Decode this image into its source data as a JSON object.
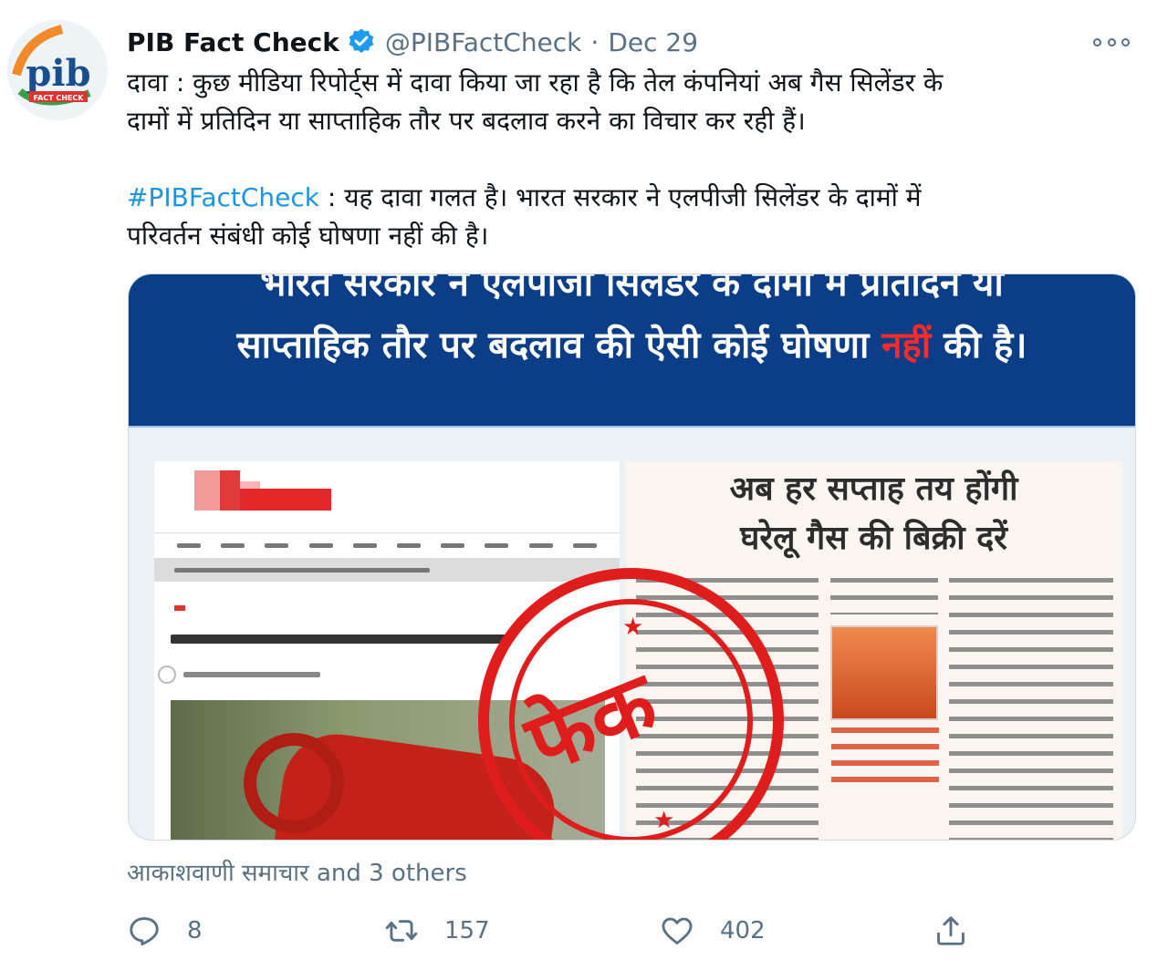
{
  "tweet": {
    "author_name": "PIB Fact Check",
    "handle": "@PIBFactCheck",
    "separator": "·",
    "date": "Dec 29",
    "avatar_logo_text": "pib",
    "avatar_sub_text": "FACT CHECK",
    "text_line1": "दावा : कुछ मीडिया रिपोर्ट्स में दावा किया जा रहा है कि तेल कंपनियां अब गैस सिलेंडर के",
    "text_line2": "दामों में प्रतिदिन या साप्ताहिक तौर पर बदलाव करने का विचार कर रही हैं।",
    "hashtag": "#PIBFactCheck",
    "text_line3_rest": " : यह दावा गलत है। भारत सरकार ने एलपीजी सिलेंडर के दामों में",
    "text_line4": "परिवर्तन संबंधी कोई घोषणा नहीं की है।"
  },
  "media": {
    "banner_line1": "भारत सरकार ने एलपीजी सिलेंडर के दामों में प्रतिदिन या",
    "banner_line2_start": "साप्ताहिक तौर पर बदलाव की ऐसी कोई घोषणा ",
    "banner_line2_red": "नहीं",
    "banner_line2_end": " की है।",
    "newspaper_headline1": "अब हर सप्ताह तय होंगी",
    "newspaper_headline2": "घरेलू गैस की बिक्री दरें",
    "stamp_text": "फेक"
  },
  "social_context": "आकाशवाणी समाचार and 3 others",
  "actions": {
    "reply_count": "8",
    "retweet_count": "157",
    "like_count": "402"
  },
  "icons": {
    "verified": "verified-badge-icon",
    "more": "more-options-icon",
    "reply": "reply-icon",
    "retweet": "retweet-icon",
    "like": "heart-icon",
    "share": "share-icon"
  },
  "colors": {
    "link": "#1b95e0",
    "muted": "#5b7083",
    "banner": "#0b3e87",
    "stamp": "#e01d1d"
  }
}
